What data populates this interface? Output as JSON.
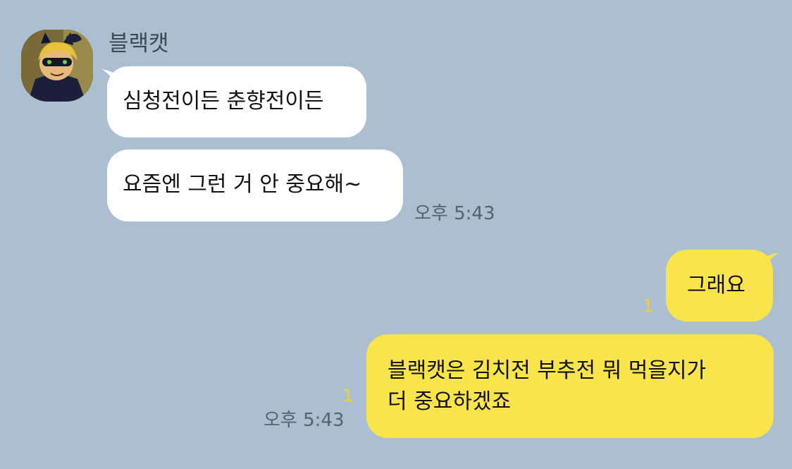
{
  "chat": {
    "sender_name": "블랙캣",
    "incoming": [
      {
        "text": "심청전이든 춘향전이든"
      },
      {
        "text": "요즘엔 그런 거 안 중요해~"
      }
    ],
    "incoming_time": "오후 5:43",
    "outgoing": [
      {
        "text": "그래요",
        "unread": "1"
      },
      {
        "line1": "블랙캣은 김치전 부추전 뭐 먹을지가",
        "line2": "더 중요하겠죠",
        "unread": "1"
      }
    ],
    "outgoing_time": "오후 5:43"
  },
  "colors": {
    "background": "#abbfd1",
    "incoming_bubble": "#ffffff",
    "outgoing_bubble": "#f9e44b",
    "unread_counter": "#f2d42c"
  }
}
